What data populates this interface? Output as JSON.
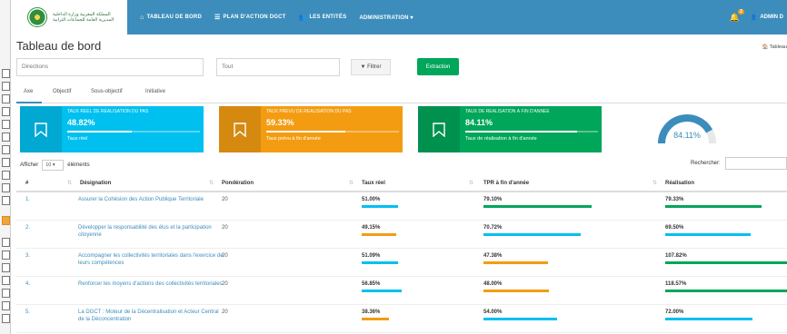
{
  "brand": {
    "logo_text": "المملكة المغربية\nوزارة الداخلية\nالمديرية العامة للجماعات الترابية"
  },
  "nav": {
    "items": [
      {
        "icon": "home-icon",
        "label": "TABLEAU DE BORD"
      },
      {
        "icon": "list-icon",
        "label": "PLAN D'ACTION DGCT"
      },
      {
        "icon": "users-icon",
        "label": "LES ENTITÉS"
      },
      {
        "icon": "",
        "label": "ADMINISTRATION ▾"
      }
    ],
    "notif_count": "2",
    "user_label": "ADMIN D"
  },
  "page": {
    "title": "Tableau de bord",
    "breadcrumb": "🏠 Tableau"
  },
  "filters": {
    "direction_placeholder": "Directions",
    "all_label": "Tout",
    "filter_btn": "▼ Filtrer",
    "extract_btn": "Extraction"
  },
  "tabs": [
    "Axe",
    "Objectif",
    "Sous-objectif",
    "Initiative"
  ],
  "info_boxes": [
    {
      "label": "TAUX RÉEL DE RÉALISATION DU PAS",
      "value": "48.82%",
      "progress": 0.4882,
      "desc": "Taux réel",
      "color": "#00c0ef"
    },
    {
      "label": "TAUX PRÉVU DE RÉALISATION DU PAS",
      "value": "59.33%",
      "progress": 0.5933,
      "desc": "Taux prévu à fin d'année",
      "color": "#f39c12"
    },
    {
      "label": "TAUX DE RÉALISATION À FIN D'ANNÉE",
      "value": "84.11%",
      "progress": 0.8411,
      "desc": "Taux de réalisation à fin d'année",
      "color": "#00a65a"
    }
  ],
  "gauge": {
    "value": 0.8411,
    "label": "84.11%",
    "color": "#3c8dbc"
  },
  "table_controls": {
    "show_prefix": "Afficher",
    "page_size": "10",
    "show_suffix": "éléments",
    "search_label": "Rechercher:"
  },
  "table": {
    "headers": [
      "#",
      "Désignation",
      "Pondération",
      "Taux réel",
      "TPR à fin d'année",
      "Réalisation"
    ],
    "rows": [
      {
        "num": "1.",
        "name": "Assurer la Cohésion des Action Publique Territoriale",
        "weight": "20",
        "taux_reel": {
          "text": "51.00%",
          "frac": 0.51,
          "color": "#00c0ef"
        },
        "tpr": {
          "text": "79.10%",
          "frac": 0.79,
          "color": "#00a65a"
        },
        "real": {
          "text": "79.33%",
          "frac": 0.79,
          "color": "#00a65a"
        }
      },
      {
        "num": "2.",
        "name": "Développer la responsabilité des élus et la participation citoyenne",
        "weight": "20",
        "taux_reel": {
          "text": "49.15%",
          "frac": 0.49,
          "color": "#f39c12"
        },
        "tpr": {
          "text": "70.72%",
          "frac": 0.71,
          "color": "#00c0ef"
        },
        "real": {
          "text": "69.50%",
          "frac": 0.7,
          "color": "#00c0ef"
        }
      },
      {
        "num": "3.",
        "name": "Accompagner les collectivités territoriales dans l'exercice de leurs compétences",
        "weight": "20",
        "taux_reel": {
          "text": "51.09%",
          "frac": 0.51,
          "color": "#00c0ef"
        },
        "tpr": {
          "text": "47.38%",
          "frac": 0.47,
          "color": "#f39c12"
        },
        "real": {
          "text": "107.82%",
          "frac": 1.0,
          "color": "#00a65a"
        }
      },
      {
        "num": "4.",
        "name": "Renforcer les moyens d'actions des collectivités territoriales",
        "weight": "20",
        "taux_reel": {
          "text": "56.85%",
          "frac": 0.57,
          "color": "#00c0ef"
        },
        "tpr": {
          "text": "48.00%",
          "frac": 0.48,
          "color": "#f39c12"
        },
        "real": {
          "text": "118.57%",
          "frac": 1.0,
          "color": "#00a65a"
        }
      },
      {
        "num": "5.",
        "name": "La DGCT : Moteur de la Décentralisation et Acteur Central de la Déconcentration",
        "weight": "20",
        "taux_reel": {
          "text": "38.36%",
          "frac": 0.38,
          "color": "#f39c12"
        },
        "tpr": {
          "text": "54.00%",
          "frac": 0.54,
          "color": "#00c0ef"
        },
        "real": {
          "text": "72.00%",
          "frac": 0.72,
          "color": "#00c0ef"
        }
      }
    ]
  }
}
